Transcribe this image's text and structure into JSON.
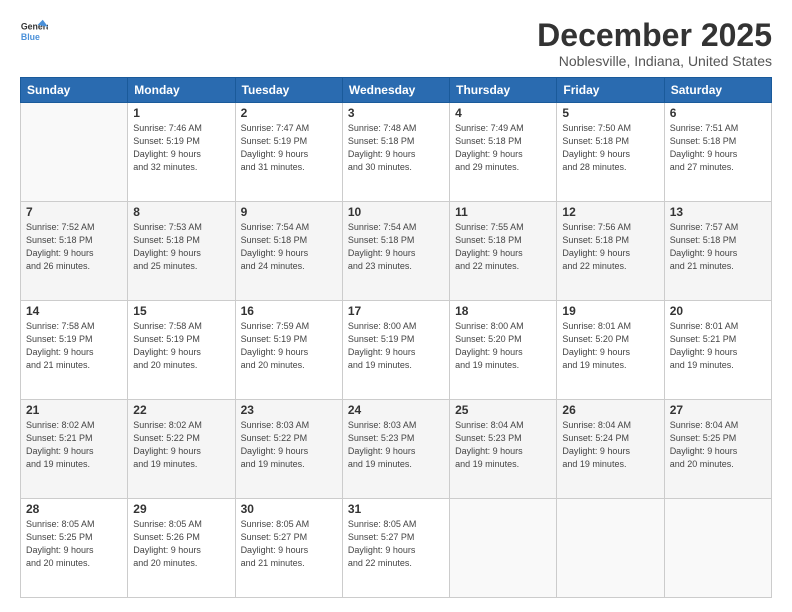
{
  "logo": {
    "line1": "General",
    "line2": "Blue"
  },
  "header": {
    "month": "December 2025",
    "location": "Noblesville, Indiana, United States"
  },
  "weekdays": [
    "Sunday",
    "Monday",
    "Tuesday",
    "Wednesday",
    "Thursday",
    "Friday",
    "Saturday"
  ],
  "weeks": [
    [
      {
        "day": "",
        "info": ""
      },
      {
        "day": "1",
        "info": "Sunrise: 7:46 AM\nSunset: 5:19 PM\nDaylight: 9 hours\nand 32 minutes."
      },
      {
        "day": "2",
        "info": "Sunrise: 7:47 AM\nSunset: 5:19 PM\nDaylight: 9 hours\nand 31 minutes."
      },
      {
        "day": "3",
        "info": "Sunrise: 7:48 AM\nSunset: 5:18 PM\nDaylight: 9 hours\nand 30 minutes."
      },
      {
        "day": "4",
        "info": "Sunrise: 7:49 AM\nSunset: 5:18 PM\nDaylight: 9 hours\nand 29 minutes."
      },
      {
        "day": "5",
        "info": "Sunrise: 7:50 AM\nSunset: 5:18 PM\nDaylight: 9 hours\nand 28 minutes."
      },
      {
        "day": "6",
        "info": "Sunrise: 7:51 AM\nSunset: 5:18 PM\nDaylight: 9 hours\nand 27 minutes."
      }
    ],
    [
      {
        "day": "7",
        "info": "Sunrise: 7:52 AM\nSunset: 5:18 PM\nDaylight: 9 hours\nand 26 minutes."
      },
      {
        "day": "8",
        "info": "Sunrise: 7:53 AM\nSunset: 5:18 PM\nDaylight: 9 hours\nand 25 minutes."
      },
      {
        "day": "9",
        "info": "Sunrise: 7:54 AM\nSunset: 5:18 PM\nDaylight: 9 hours\nand 24 minutes."
      },
      {
        "day": "10",
        "info": "Sunrise: 7:54 AM\nSunset: 5:18 PM\nDaylight: 9 hours\nand 23 minutes."
      },
      {
        "day": "11",
        "info": "Sunrise: 7:55 AM\nSunset: 5:18 PM\nDaylight: 9 hours\nand 22 minutes."
      },
      {
        "day": "12",
        "info": "Sunrise: 7:56 AM\nSunset: 5:18 PM\nDaylight: 9 hours\nand 22 minutes."
      },
      {
        "day": "13",
        "info": "Sunrise: 7:57 AM\nSunset: 5:18 PM\nDaylight: 9 hours\nand 21 minutes."
      }
    ],
    [
      {
        "day": "14",
        "info": "Sunrise: 7:58 AM\nSunset: 5:19 PM\nDaylight: 9 hours\nand 21 minutes."
      },
      {
        "day": "15",
        "info": "Sunrise: 7:58 AM\nSunset: 5:19 PM\nDaylight: 9 hours\nand 20 minutes."
      },
      {
        "day": "16",
        "info": "Sunrise: 7:59 AM\nSunset: 5:19 PM\nDaylight: 9 hours\nand 20 minutes."
      },
      {
        "day": "17",
        "info": "Sunrise: 8:00 AM\nSunset: 5:19 PM\nDaylight: 9 hours\nand 19 minutes."
      },
      {
        "day": "18",
        "info": "Sunrise: 8:00 AM\nSunset: 5:20 PM\nDaylight: 9 hours\nand 19 minutes."
      },
      {
        "day": "19",
        "info": "Sunrise: 8:01 AM\nSunset: 5:20 PM\nDaylight: 9 hours\nand 19 minutes."
      },
      {
        "day": "20",
        "info": "Sunrise: 8:01 AM\nSunset: 5:21 PM\nDaylight: 9 hours\nand 19 minutes."
      }
    ],
    [
      {
        "day": "21",
        "info": "Sunrise: 8:02 AM\nSunset: 5:21 PM\nDaylight: 9 hours\nand 19 minutes."
      },
      {
        "day": "22",
        "info": "Sunrise: 8:02 AM\nSunset: 5:22 PM\nDaylight: 9 hours\nand 19 minutes."
      },
      {
        "day": "23",
        "info": "Sunrise: 8:03 AM\nSunset: 5:22 PM\nDaylight: 9 hours\nand 19 minutes."
      },
      {
        "day": "24",
        "info": "Sunrise: 8:03 AM\nSunset: 5:23 PM\nDaylight: 9 hours\nand 19 minutes."
      },
      {
        "day": "25",
        "info": "Sunrise: 8:04 AM\nSunset: 5:23 PM\nDaylight: 9 hours\nand 19 minutes."
      },
      {
        "day": "26",
        "info": "Sunrise: 8:04 AM\nSunset: 5:24 PM\nDaylight: 9 hours\nand 19 minutes."
      },
      {
        "day": "27",
        "info": "Sunrise: 8:04 AM\nSunset: 5:25 PM\nDaylight: 9 hours\nand 20 minutes."
      }
    ],
    [
      {
        "day": "28",
        "info": "Sunrise: 8:05 AM\nSunset: 5:25 PM\nDaylight: 9 hours\nand 20 minutes."
      },
      {
        "day": "29",
        "info": "Sunrise: 8:05 AM\nSunset: 5:26 PM\nDaylight: 9 hours\nand 20 minutes."
      },
      {
        "day": "30",
        "info": "Sunrise: 8:05 AM\nSunset: 5:27 PM\nDaylight: 9 hours\nand 21 minutes."
      },
      {
        "day": "31",
        "info": "Sunrise: 8:05 AM\nSunset: 5:27 PM\nDaylight: 9 hours\nand 22 minutes."
      },
      {
        "day": "",
        "info": ""
      },
      {
        "day": "",
        "info": ""
      },
      {
        "day": "",
        "info": ""
      }
    ]
  ]
}
